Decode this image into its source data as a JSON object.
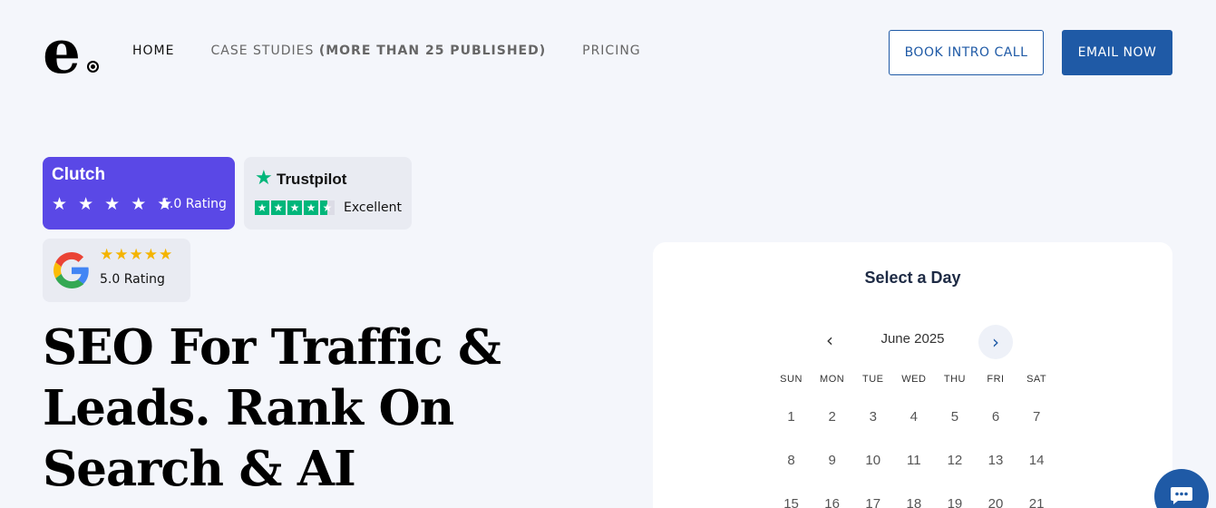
{
  "header": {
    "logo_letter": "e",
    "nav": [
      {
        "label": "HOME"
      },
      {
        "label": "CASE STUDIES",
        "suffix": "(MORE THAN 25 PUBLISHED)"
      },
      {
        "label": "PRICING"
      }
    ],
    "book_label": "BOOK INTRO CALL",
    "email_label": "EMAIL NOW"
  },
  "badges": {
    "clutch": {
      "name": "Clutch",
      "stars": "★ ★ ★ ★ ★",
      "rating": "5.0 Rating",
      "color": "#5a48e6"
    },
    "trustpilot": {
      "name": "Trustpilot",
      "rating": "Excellent",
      "color": "#00b67a"
    },
    "google": {
      "stars": "★★★★★",
      "rating": "5.0 Rating"
    }
  },
  "hero": {
    "headline": "SEO For Traffic & Leads. Rank On Search & AI"
  },
  "calendar": {
    "title": "Select a Day",
    "month": "June 2025",
    "weekdays": [
      "SUN",
      "MON",
      "TUE",
      "WED",
      "THU",
      "FRI",
      "SAT"
    ],
    "weeks": [
      [
        "1",
        "2",
        "3",
        "4",
        "5",
        "6",
        "7"
      ],
      [
        "8",
        "9",
        "10",
        "11",
        "12",
        "13",
        "14"
      ],
      [
        "15",
        "16",
        "17",
        "18",
        "19",
        "20",
        "21"
      ]
    ]
  },
  "colors": {
    "accent": "#1f5aa6",
    "background": "#f4f6fb"
  }
}
